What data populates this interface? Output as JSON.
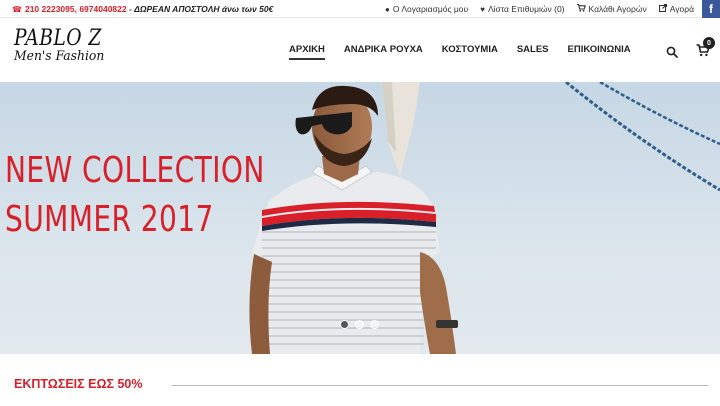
{
  "topbar": {
    "phones": "210 2223095, 6974040822",
    "separator": " - ",
    "shipping": "ΔΩΡΕΑΝ ΑΠΟΣΤΟΛΗ άνω των 50€",
    "account": "Ο Λογαριασμός μου",
    "wishlist": "Λίστα Επιθυμιών (0)",
    "cart": "Καλάθι Αγορών",
    "checkout": "Αγορά",
    "facebook": "f"
  },
  "logo": {
    "line1": "PABLO Z",
    "line2": "Men's Fashion"
  },
  "nav": {
    "items": [
      "ΑΡΧΙΚΗ",
      "ΑΝΔΡΙΚΑ ΡΟΥΧΑ",
      "ΚΟΣΤΟΥΜΙΑ",
      "SALES",
      "ΕΠΙΚΟΙΝΩΝΙΑ"
    ],
    "active": "ΑΡΧΙΚΗ"
  },
  "cart_count": "0",
  "hero": {
    "line1": "NEW COLLECTION",
    "line2": "SUMMER 2017",
    "slides": 3,
    "active_slide": 1
  },
  "sale_heading": "ΕΚΠΤΩΣΕΙΣ ΕΩΣ 50%",
  "colors": {
    "accent": "#d9202a",
    "facebook": "#3b5998"
  }
}
